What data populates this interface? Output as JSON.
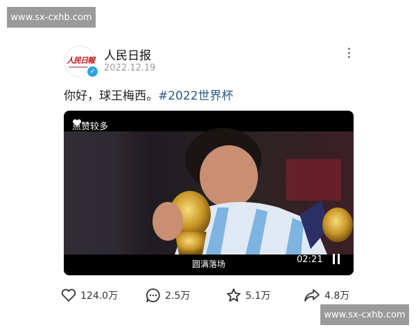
{
  "watermark": {
    "top": "www.sx-cxhb.com",
    "bottom": "www.sx-cxhb.com"
  },
  "post": {
    "author": "人民日报",
    "avatar_text": "人民日報",
    "date": "2022.12.19",
    "text": "你好，球王梅西。",
    "hashtag": "#2022世界杯"
  },
  "video": {
    "badge_label": "点赞较多",
    "caption": "圆满落场",
    "duration": "02:21"
  },
  "actions": {
    "like_count": "124.0万",
    "comment_count": "2.5万",
    "favorite_count": "5.1万",
    "share_count": "4.8万"
  },
  "colors": {
    "hashtag": "#2a5c7e",
    "verified": "#2fa3dd",
    "watermark_bg": "#9a9a9a"
  }
}
